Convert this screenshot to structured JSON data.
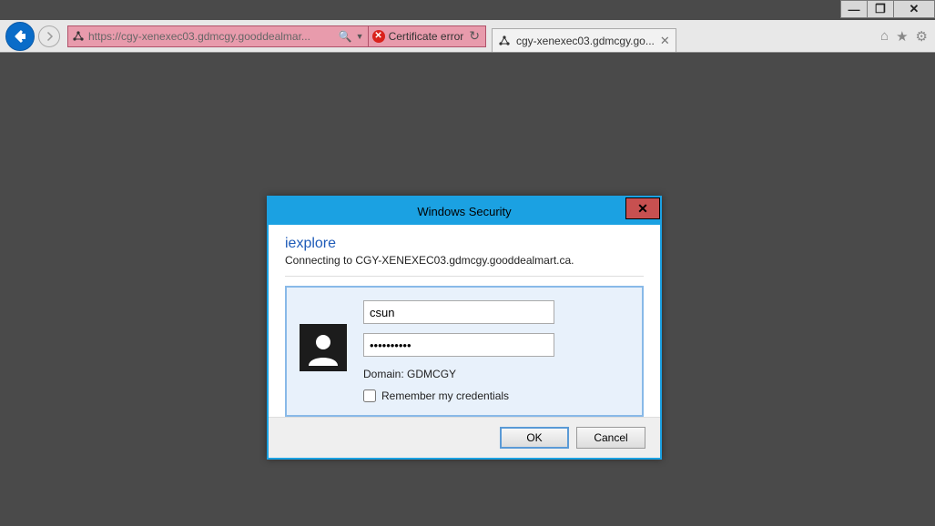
{
  "window": {
    "minimize": "─",
    "maximize": "❐",
    "close": "✕"
  },
  "browser": {
    "url_display": "https://cgy-xenexec03.gdmcgy.gooddealmar...",
    "cert_error_label": "Certificate error",
    "tab_title": "cgy-xenexec03.gdmcgy.go...",
    "icons": {
      "home": "⌂",
      "favorites": "★",
      "tools": "⚙"
    }
  },
  "dialog": {
    "title": "Windows Security",
    "app_name": "iexplore",
    "connecting_prefix": "Connecting to ",
    "connecting_host": "CGY-XENEXEC03.gdmcgy.gooddealmart.ca.",
    "username_value": "csun",
    "password_value": "••••••••••",
    "domain_label": "Domain: ",
    "domain_value": "GDMCGY",
    "remember_label": "Remember my credentials",
    "ok_label": "OK",
    "cancel_label": "Cancel"
  }
}
